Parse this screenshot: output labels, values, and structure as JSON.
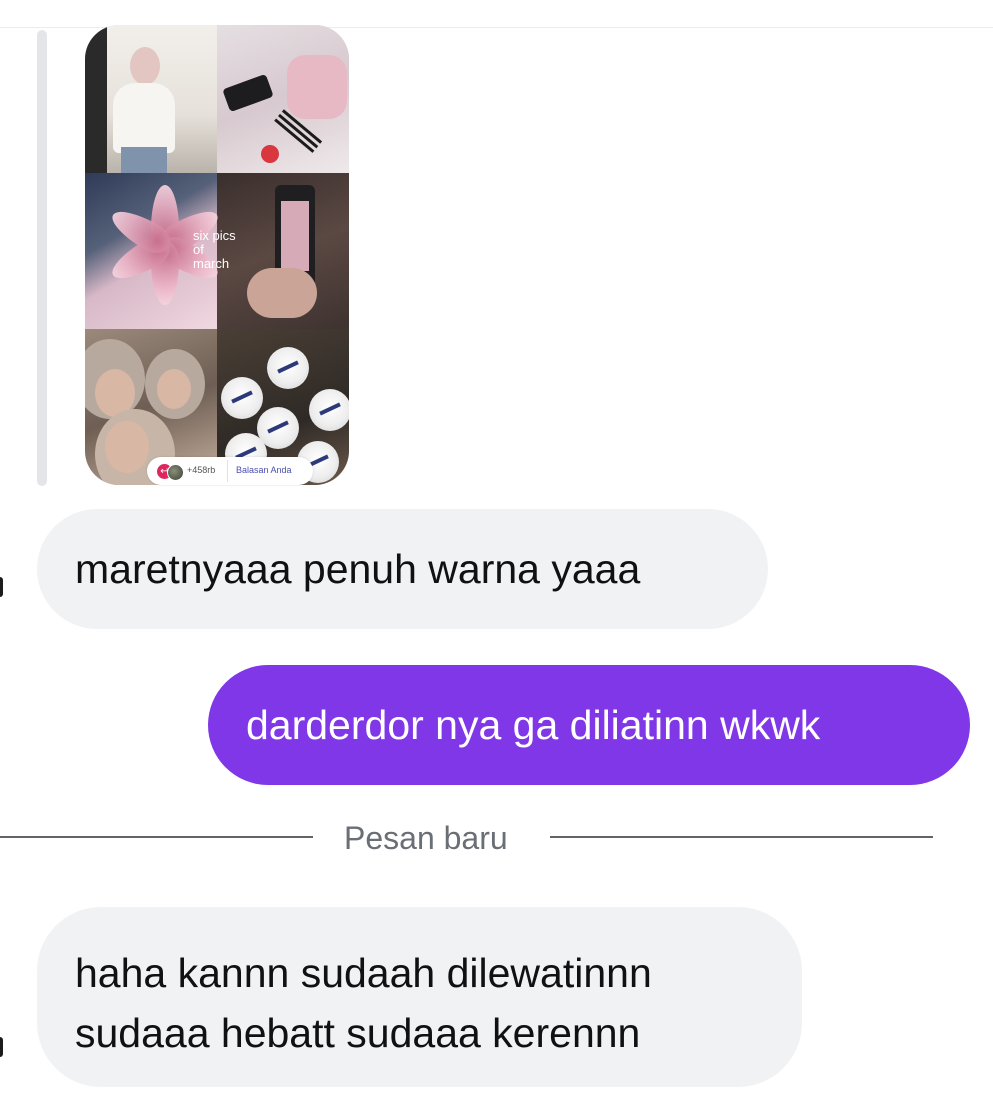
{
  "story_reply": {
    "flower_text": [
      "six pics",
      "of",
      "march"
    ],
    "reaction_count": "+458rb",
    "reply_button_label": "Balasan Anda"
  },
  "messages": [
    {
      "direction": "incoming",
      "text": "maretnyaaa penuh warna yaaa"
    },
    {
      "direction": "outgoing",
      "text": "darderdor nya ga diliatinn wkwk"
    }
  ],
  "new_messages_divider": "Pesan baru",
  "messages_after_divider": [
    {
      "direction": "incoming",
      "lines": [
        "haha kannn sudaah dilewatinnn",
        "sudaaa hebatt sudaaa kerennn"
      ]
    }
  ],
  "colors": {
    "outgoing_bubble": "#7f37e8",
    "incoming_bubble": "#f1f2f4",
    "reply_accent": "#e0265f"
  },
  "icons": {
    "reply": "reply-arrow-icon"
  }
}
